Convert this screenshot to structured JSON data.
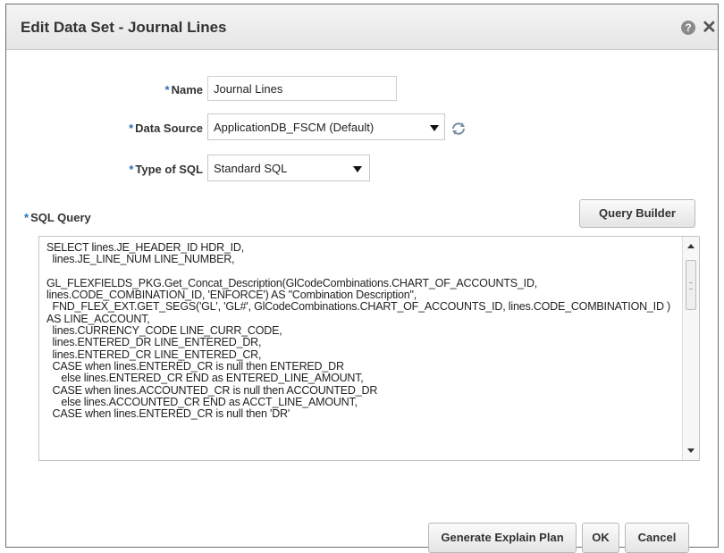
{
  "dialog": {
    "title": "Edit Data Set - Journal Lines",
    "help_glyph": "?",
    "close_glyph": "✕"
  },
  "form": {
    "required_marker": "*",
    "name_label": "Name",
    "name_value": "Journal Lines",
    "data_source_label": "Data Source",
    "data_source_value": "ApplicationDB_FSCM (Default)",
    "type_of_sql_label": "Type of SQL",
    "type_of_sql_value": "Standard SQL",
    "sql_query_label": "SQL Query",
    "query_builder_label": "Query Builder",
    "sql_query_text": "SELECT lines.JE_HEADER_ID HDR_ID,\n  lines.JE_LINE_NUM LINE_NUMBER,\n\nGL_FLEXFIELDS_PKG.Get_Concat_Description(GlCodeCombinations.CHART_OF_ACCOUNTS_ID, lines.CODE_COMBINATION_ID, 'ENFORCE') AS \"Combination Description\",\n  FND_FLEX_EXT.GET_SEGS('GL', 'GL#', GlCodeCombinations.CHART_OF_ACCOUNTS_ID, lines.CODE_COMBINATION_ID ) AS LINE_ACCOUNT,\n  lines.CURRENCY_CODE LINE_CURR_CODE,\n  lines.ENTERED_DR LINE_ENTERED_DR,\n  lines.ENTERED_CR LINE_ENTERED_CR,\n  CASE when lines.ENTERED_CR is null then ENTERED_DR\n     else lines.ENTERED_CR END as ENTERED_LINE_AMOUNT,\n  CASE when lines.ACCOUNTED_CR is null then ACCOUNTED_DR\n     else lines.ACCOUNTED_CR END as ACCT_LINE_AMOUNT,\n  CASE when lines.ENTERED_CR is null then 'DR'"
  },
  "footer": {
    "explain_plan_label": "Generate Explain Plan",
    "ok_label": "OK",
    "cancel_label": "Cancel"
  },
  "colors": {
    "required_marker": "#2a6ebb",
    "dialog_border": "#6e6e6e"
  },
  "icons": {
    "help": "help-icon",
    "close": "close-icon",
    "dropdown": "chevron-down-icon",
    "refresh": "refresh-icon"
  }
}
